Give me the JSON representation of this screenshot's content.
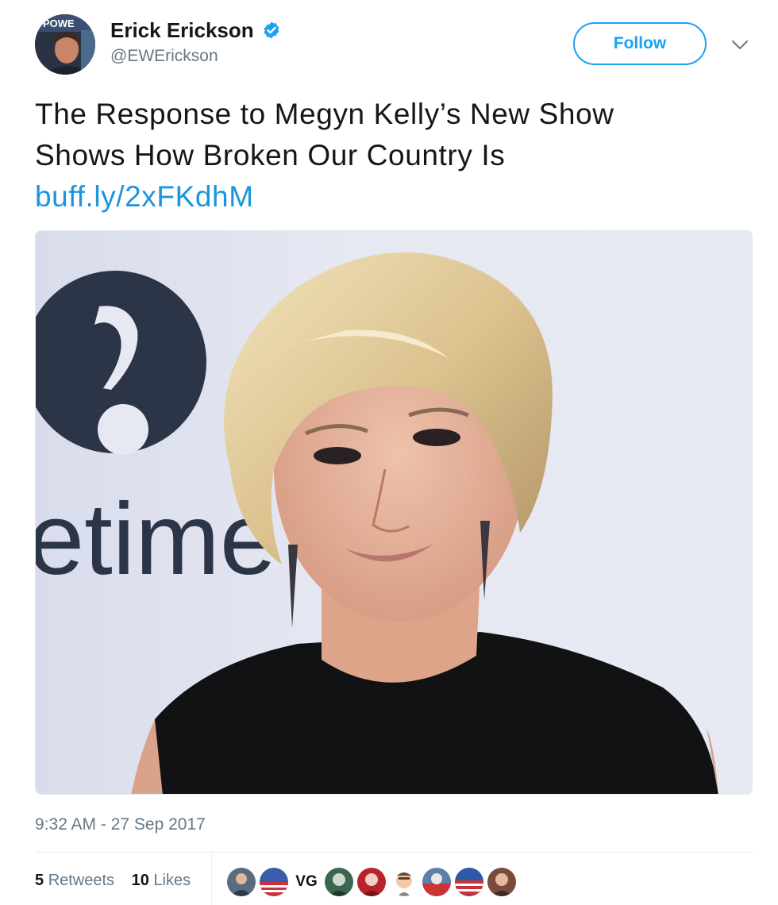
{
  "author": {
    "display_name": "Erick Erickson",
    "handle": "@EWErickson",
    "verified": true,
    "avatar_icon": "user-avatar-photo",
    "avatar_lettering": "POWE"
  },
  "header": {
    "follow_label": "Follow",
    "menu_icon": "chevron-down-icon"
  },
  "tweet": {
    "text_line1": "The Response to Megyn Kelly’s New Show",
    "text_line2": "Shows How Broken Our Country Is",
    "link_text": "buff.ly/2xFKdhM"
  },
  "media": {
    "description_icon": "photo-woman-portrait",
    "background_logo_text": "etime"
  },
  "meta": {
    "timestamp": "9:32 AM - 27 Sep 2017",
    "retweets_count": "5",
    "retweets_label": "Retweets",
    "likes_count": "10",
    "likes_label": "Likes"
  },
  "liker_avatars": [
    {
      "icon": "user-avatar",
      "color": "#5a6b7d"
    },
    {
      "icon": "flag-avatar",
      "color": "#3b5bab"
    },
    {
      "icon": "monogram-avatar",
      "color": "#ffffff",
      "text": "VG"
    },
    {
      "icon": "user-avatar",
      "color": "#3d6650"
    },
    {
      "icon": "user-avatar",
      "color": "#b8242c"
    },
    {
      "icon": "emoji-avatar",
      "color": "#ffffff"
    },
    {
      "icon": "user-avatar",
      "color": "#5b7fa8"
    },
    {
      "icon": "flag-avatar",
      "color": "#2f58a8"
    },
    {
      "icon": "user-avatar",
      "color": "#7a4a3c"
    }
  ],
  "colors": {
    "accent": "#1da1f2",
    "link": "#1b95e0",
    "secondary_text": "#657786"
  }
}
